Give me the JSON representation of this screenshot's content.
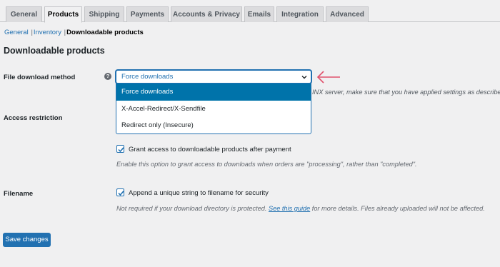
{
  "tabs": [
    {
      "label": "General"
    },
    {
      "label": "Products"
    },
    {
      "label": "Shipping"
    },
    {
      "label": "Payments"
    },
    {
      "label": "Accounts & Privacy"
    },
    {
      "label": "Emails"
    },
    {
      "label": "Integration"
    },
    {
      "label": "Advanced"
    }
  ],
  "active_tab": "Products",
  "subnav": {
    "general": "General",
    "sep1": "|",
    "inventory": "Inventory",
    "sep2": "|",
    "current": "Downloadable products"
  },
  "section_title": "Downloadable products",
  "file_download_method": {
    "label": "File download method",
    "help_icon": "?",
    "selected_value": "Force downloads",
    "options": [
      "Force downloads",
      "X-Accel-Redirect/X-Sendfile",
      "Redirect only (Insecure)"
    ],
    "desc_fragment": "INX server, make sure that you have applied settings as described"
  },
  "access_restriction": {
    "label": "Access restriction",
    "checkbox_label": "Grant access to downloadable products after payment",
    "checked": true,
    "description": "Enable this option to grant access to downloads when orders are \"processing\", rather than \"completed\"."
  },
  "filename": {
    "label": "Filename",
    "checkbox_label": "Append a unique string to filename for security",
    "checked": true,
    "description_before": "Not required if your download directory is protected.",
    "link_text": "See this guide",
    "description_after": "for more details. Files already uploaded will not be affected."
  },
  "save_button": "Save changes",
  "colors": {
    "accent": "#2271b1",
    "selected_option": "#0073aa",
    "annotation_arrow": "#e0506b",
    "background": "#f0f0f1"
  },
  "icons": {
    "help": "question-circle-icon",
    "select_chevron": "chevron-down-icon",
    "annotation": "left-arrow-icon",
    "checkbox": "checkmark-icon"
  }
}
